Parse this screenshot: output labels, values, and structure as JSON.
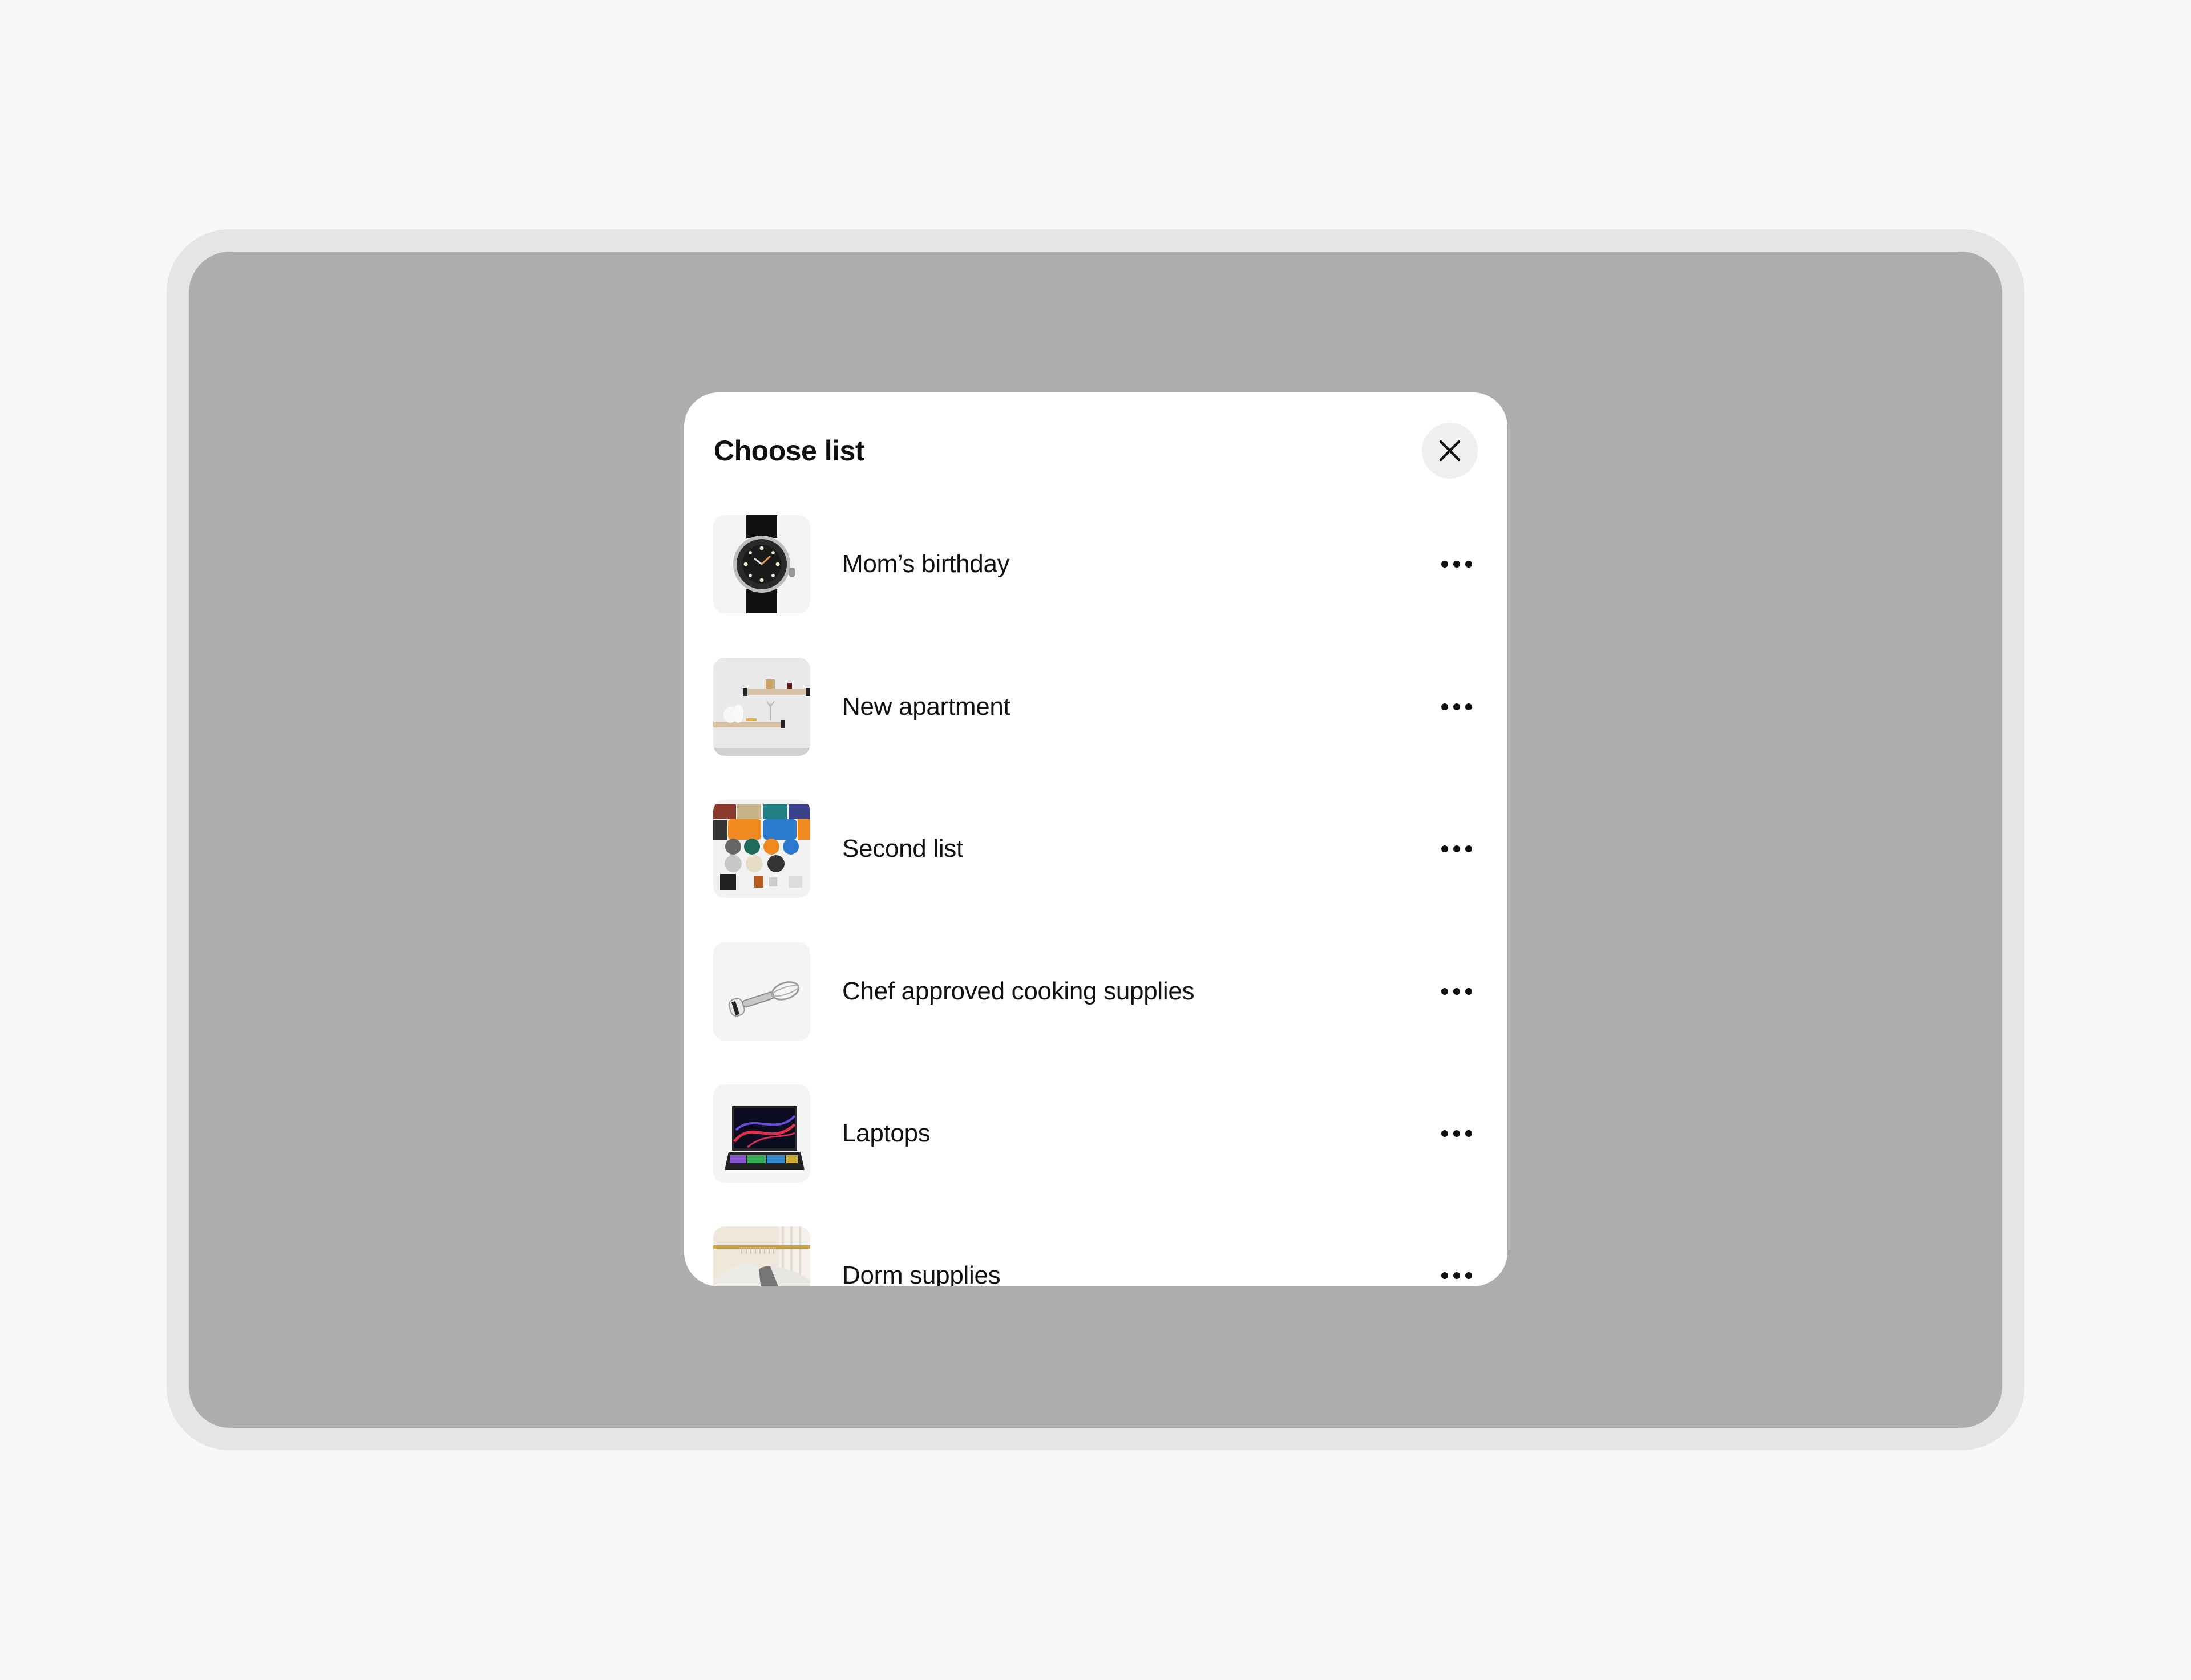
{
  "colors": {
    "page_background": "#f7f7f7",
    "device_frame": "#e5e5e5",
    "scrim": "#adadad",
    "modal_background": "#ffffff",
    "close_button_background": "#efefef",
    "text": "#111111"
  },
  "modal": {
    "title": "Choose list",
    "close_icon": "close-icon",
    "close_label": "Close",
    "more_icon": "more-horizontal-icon",
    "lists": [
      {
        "name": "Mom’s birthday",
        "thumbnail": "wristwatch-image",
        "more_label": "More options for Mom’s birthday"
      },
      {
        "name": "New apartment",
        "thumbnail": "wall-shelves-image",
        "more_label": "More options for New apartment"
      },
      {
        "name": "Second list",
        "thumbnail": "game-consoles-image",
        "more_label": "More options for Second list"
      },
      {
        "name": "Chef approved cooking supplies",
        "thumbnail": "egg-beater-image",
        "more_label": "More options for Chef approved cooking supplies"
      },
      {
        "name": "Laptops",
        "thumbnail": "gaming-laptop-image",
        "more_label": "More options for Laptops"
      },
      {
        "name": "Dorm supplies",
        "thumbnail": "clothes-hangers-image",
        "more_label": "More options for Dorm supplies"
      }
    ]
  }
}
